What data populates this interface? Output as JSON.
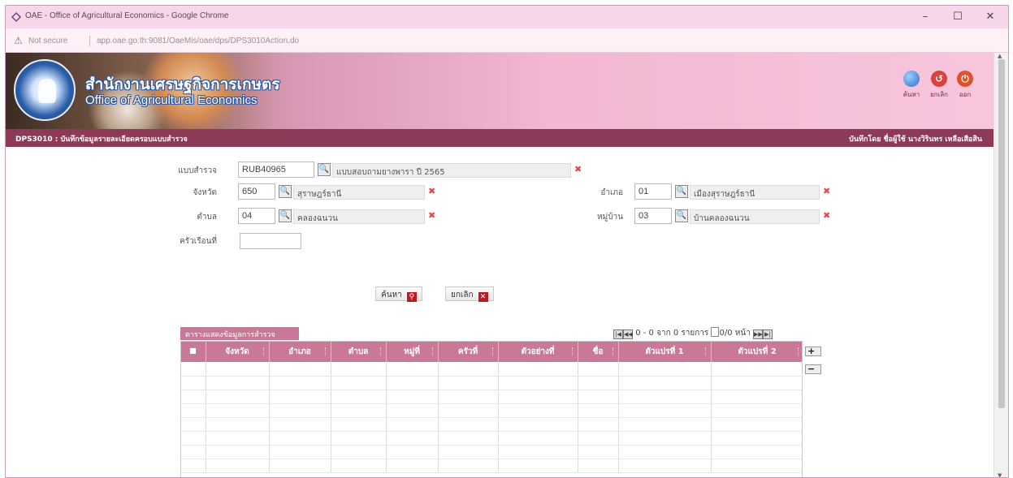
{
  "window": {
    "title": "OAE - Office of Agricultural Economics - Google Chrome",
    "controls": {
      "minimize": "–",
      "maximize": "☐",
      "close": "✕"
    }
  },
  "address_bar": {
    "security_label": "Not secure",
    "url": "app.oae.go.th:9081/OaeMis/oae/dps/DPS3010Action.do"
  },
  "banner": {
    "org_name_th": "สำนักงานเศรษฐกิจการเกษตร",
    "org_name_en": "Office of Agricultural Economics",
    "actions": [
      {
        "label": "ค้นหา",
        "icon": "globe-icon",
        "color": "#3a7bd5"
      },
      {
        "label": "ยกเลิก",
        "icon": "cancel-icon",
        "color": "#d9433b"
      },
      {
        "label": "ออก",
        "icon": "power-icon",
        "color": "#e0502a"
      }
    ]
  },
  "page_bar": {
    "code": "DPS3010 : บันทึกข้อมูลรายละเอียดครอบแบบสำรวจ",
    "user": "บันทึกโดย ชื่อผู้ใช้ นางวิรินทร เหลือเสือสิน"
  },
  "form": {
    "survey": {
      "label": "แบบสำรวจ",
      "code": "RUB40965",
      "name": "แบบสอบถามยางพารา ปี 2565"
    },
    "province": {
      "label": "จังหวัด",
      "code": "650",
      "name": "สุราษฎร์ธานี"
    },
    "district": {
      "label": "อำเภอ",
      "code": "01",
      "name": "เมืองสุราษฎร์ธานี"
    },
    "subdistrict": {
      "label": "ตำบล",
      "code": "04",
      "name": "คลองฉนวน"
    },
    "village": {
      "label": "หมู่บ้าน",
      "code": "03",
      "name": "บ้านคลองฉนวน"
    },
    "household": {
      "label": "ครัวเรือนที่",
      "code": ""
    }
  },
  "buttons": {
    "search": "ค้นหา",
    "cancel": "ยกเลิก"
  },
  "grid": {
    "caption": "ตารางแสดงข้อมูลการสำรวจ",
    "pager": {
      "start": "0",
      "sep": "-",
      "end": "0",
      "of": "จาก",
      "total": "0",
      "records": "รายการ",
      "page": "0",
      "pages": "/0",
      "page_label": "หน้า"
    },
    "columns": [
      "จังหวัด",
      "อำเภอ",
      "ตำบล",
      "หมู่ที่",
      "ครัวที่",
      "ตัวอย่างที่",
      "ชื่อ",
      "ตัวแปรที่ 1",
      "ตัวแปรที่ 2"
    ],
    "empty_rows": 8
  }
}
